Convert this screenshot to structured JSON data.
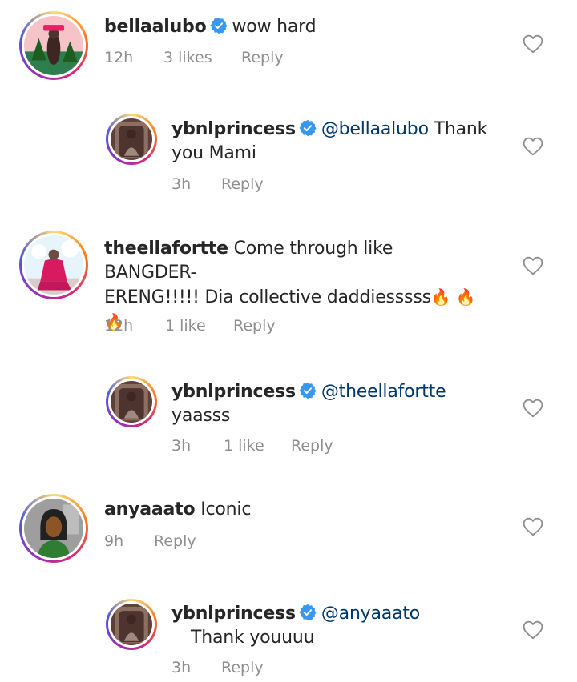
{
  "comments": [
    {
      "username": "bellaalubo",
      "verified": true,
      "text": "wow hard",
      "time": "12h",
      "likes": "3 likes",
      "reply": "Reply"
    },
    {
      "username": "ybnlprincess",
      "verified": true,
      "mention": "@bellaalubo",
      "text_line1": "Thank",
      "text_line2": "you Mami",
      "time": "3h",
      "reply": "Reply"
    },
    {
      "username": "theellafortte",
      "verified": false,
      "text_line1": "Come through like BANGDER-",
      "text_line2": "ERENG!!!!! Dia collective daddiesssss",
      "emoji_line2": "🔥 🔥",
      "emoji_line3": "🔥",
      "time": "12h",
      "likes": "1 like",
      "reply": "Reply"
    },
    {
      "username": "ybnlprincess",
      "verified": true,
      "mention": "@theellafortte",
      "text_line2": "yaasss",
      "time": "3h",
      "likes": "1 like",
      "reply": "Reply"
    },
    {
      "username": "anyaaato",
      "verified": false,
      "text": "Iconic",
      "time": "9h",
      "reply": "Reply"
    },
    {
      "username": "ybnlprincess",
      "verified": true,
      "mention": "@anyaaato",
      "text_line2": "Thank youuuu",
      "time": "3h",
      "reply": "Reply"
    }
  ],
  "icons": {
    "verified": "verified-badge-icon",
    "like": "heart-outline-icon"
  },
  "colors": {
    "verified": "#3897f0",
    "mention": "#00376b",
    "meta": "#8e8e8e"
  }
}
